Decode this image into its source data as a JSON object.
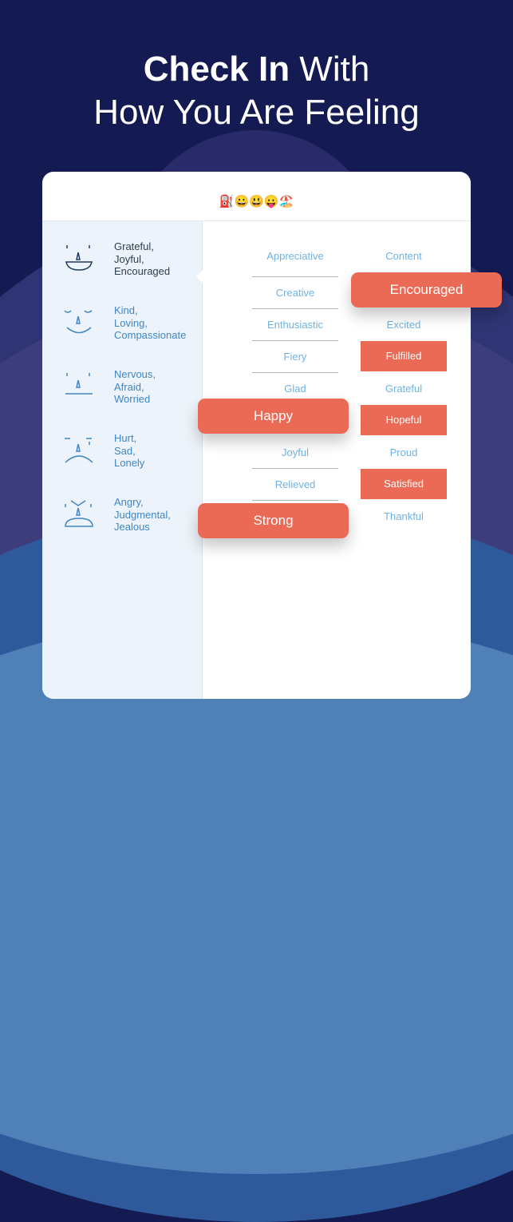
{
  "headline": {
    "bold": "Check In",
    "rest_line1": " With",
    "line2": "How You Are Feeling"
  },
  "card": {
    "title_emojis": "⛽😀😃😛🏖️",
    "moods": [
      {
        "face": "happy-face",
        "label": "Grateful,\nJoyful,\nEncouraged",
        "lines": [
          "Grateful,",
          "Joyful,",
          "Encouraged"
        ],
        "active": true
      },
      {
        "face": "content-face",
        "lines": [
          "Kind,",
          "Loving,",
          "Compassionate"
        ],
        "active": false
      },
      {
        "face": "nervous-face",
        "lines": [
          "Nervous,",
          "Afraid,",
          "Worried"
        ],
        "active": false
      },
      {
        "face": "sad-face",
        "lines": [
          "Hurt,",
          "Sad,",
          "Lonely"
        ],
        "active": false
      },
      {
        "face": "angry-face",
        "lines": [
          "Angry,",
          "Judgmental,",
          "Jealous"
        ],
        "active": false
      }
    ],
    "words_left": [
      {
        "label": "Appreciative",
        "selected": false
      },
      {
        "label": "Creative",
        "selected": false
      },
      {
        "label": "Enthusiastic",
        "selected": false
      },
      {
        "label": "Fiery",
        "selected": false
      },
      {
        "label": "Glad",
        "selected": false
      },
      {
        "label": "Happy",
        "selected": true
      },
      {
        "label": "Joyful",
        "selected": false
      },
      {
        "label": "Relieved",
        "selected": false
      },
      {
        "label": "Strong",
        "selected": true
      }
    ],
    "words_right": [
      {
        "label": "Content",
        "selected": false
      },
      {
        "label": "Encouraged",
        "selected": true
      },
      {
        "label": "Excited",
        "selected": false
      },
      {
        "label": "Fulfilled",
        "selected": true
      },
      {
        "label": "Grateful",
        "selected": false
      },
      {
        "label": "Hopeful",
        "selected": true
      },
      {
        "label": "Proud",
        "selected": false
      },
      {
        "label": "Satisfied",
        "selected": true
      },
      {
        "label": "Thankful",
        "selected": false
      }
    ]
  },
  "colors": {
    "background": "#141a52",
    "accent": "#ea6a55",
    "word_text": "#6fb3e2",
    "mood_text": "#3f86c4",
    "sidebar_bg": "#edf3fa"
  }
}
